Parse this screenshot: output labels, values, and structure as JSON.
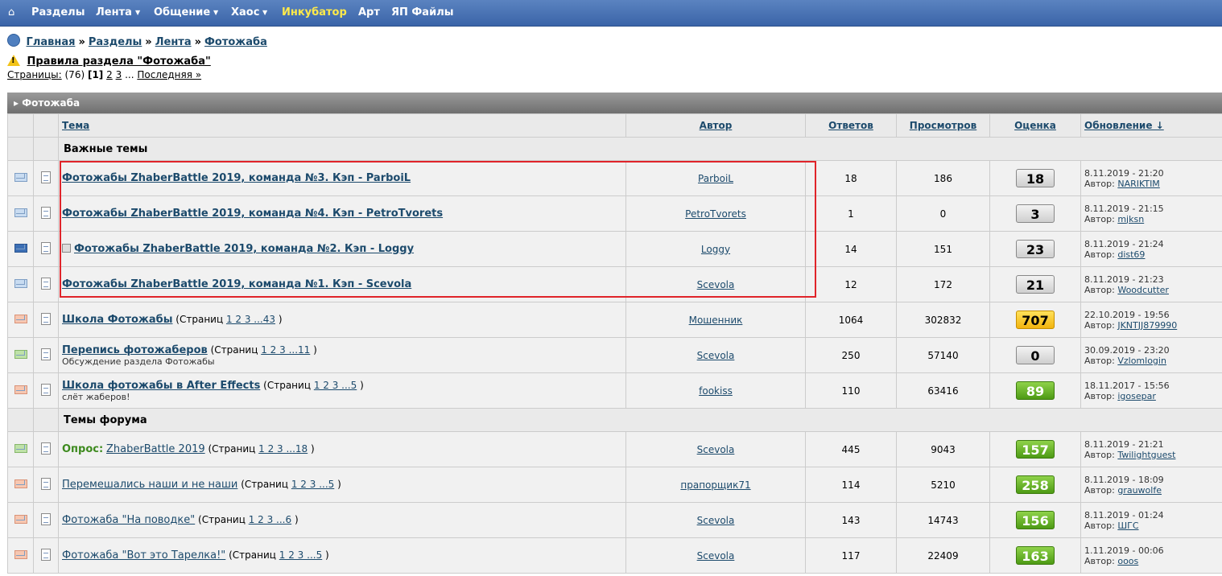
{
  "nav": {
    "home_icon": "home-icon",
    "items": [
      {
        "label": "Разделы",
        "caret": false
      },
      {
        "label": "Лента",
        "caret": true
      },
      {
        "label": "Общение",
        "caret": true
      },
      {
        "label": "Хаос",
        "caret": true
      },
      {
        "label": "Инкубатор",
        "caret": false,
        "highlight": true
      },
      {
        "label": "Арт",
        "caret": false
      },
      {
        "label": "ЯП Файлы",
        "caret": false
      }
    ]
  },
  "breadcrumb": [
    "Главная",
    "Разделы",
    "Лента",
    "Фотожаба"
  ],
  "breadcrumb_sep": "»",
  "rules_link": "Правила раздела \"Фотожаба\"",
  "pagination": {
    "label": "Страницы:",
    "count": "(76)",
    "current": "[1]",
    "pages": [
      "2",
      "3"
    ],
    "ellipsis": "...",
    "last": "Последняя »"
  },
  "forum": {
    "title": "Фотожаба",
    "columns": {
      "topic": "Тема",
      "author": "Автор",
      "replies": "Ответов",
      "views": "Просмотров",
      "rating": "Оценка",
      "updated": "Обновление ↓"
    },
    "sections": [
      {
        "title": "Важные темы",
        "rows": [
          {
            "env": "light",
            "title": "Фотожабы ZhaberBattle 2019, команда №3. Кэп - ParboiL",
            "bold": true,
            "author": "ParboiL",
            "replies": "18",
            "views": "186",
            "rating": "18",
            "rcolor": "gray",
            "date": "8.11.2019 - 21:20",
            "by_label": "Автор:",
            "by": "NARIKTIM"
          },
          {
            "env": "light",
            "title": "Фотожабы ZhaberBattle 2019, команда №4. Кэп - PetroTvorets",
            "bold": true,
            "author": "PetroTvorets",
            "replies": "1",
            "views": "0",
            "rating": "3",
            "rcolor": "gray",
            "date": "8.11.2019 - 21:15",
            "by_label": "Автор:",
            "by": "mjksn"
          },
          {
            "env": "dark",
            "title": "Фотожабы ZhaberBattle 2019, команда №2. Кэп - Loggy",
            "bold": true,
            "mini": true,
            "author": "Loggy",
            "replies": "14",
            "views": "151",
            "rating": "23",
            "rcolor": "gray",
            "date": "8.11.2019 - 21:24",
            "by_label": "Автор:",
            "by": "dist69"
          },
          {
            "env": "light",
            "title": "Фотожабы ZhaberBattle 2019, команда №1. Кэп - Scevola",
            "bold": true,
            "author": "Scevola",
            "replies": "12",
            "views": "172",
            "rating": "21",
            "rcolor": "gray",
            "date": "8.11.2019 - 21:23",
            "by_label": "Автор:",
            "by": "Woodcutter"
          },
          {
            "env": "orange",
            "title": "Школа Фотожабы",
            "bold": true,
            "pages_pre": "(Страниц ",
            "pages": "1 2 3 ...43",
            "pages_post": ")",
            "author": "Мошенник",
            "replies": "1064",
            "views": "302832",
            "rating": "707",
            "rcolor": "yellow",
            "date": "22.10.2019 - 19:56",
            "by_label": "Автор:",
            "by": "JKNTJJ879990"
          },
          {
            "env": "green",
            "title": "Перепись фотожаберов",
            "bold": true,
            "pages_pre": "(Страниц ",
            "pages": "1 2 3 ...11",
            "pages_post": ")",
            "sub": "Обсуждение раздела Фотожабы",
            "author": "Scevola",
            "replies": "250",
            "views": "57140",
            "rating": "0",
            "rcolor": "gray",
            "date": "30.09.2019 - 23:20",
            "by_label": "Автор:",
            "by": "Vzlomlogin"
          },
          {
            "env": "orange",
            "title": "Школа фотожабы в After Effects",
            "bold": true,
            "pages_pre": "(Страниц ",
            "pages": "1 2 3 ...5",
            "pages_post": ")",
            "sub": "слёт жаберов!",
            "author": "fookiss",
            "replies": "110",
            "views": "63416",
            "rating": "89",
            "rcolor": "green",
            "date": "18.11.2017 - 15:56",
            "by_label": "Автор:",
            "by": "igosepar"
          }
        ]
      },
      {
        "title": "Темы форума",
        "rows": [
          {
            "env": "green",
            "poll": "Опрос:",
            "title": "ZhaberBattle 2019",
            "bold": false,
            "pages_pre": "(Страниц ",
            "pages": "1 2 3 ...18",
            "pages_post": ")",
            "author": "Scevola",
            "replies": "445",
            "views": "9043",
            "rating": "157",
            "rcolor": "green",
            "date": "8.11.2019 - 21:21",
            "by_label": "Автор:",
            "by": "Twilightguest"
          },
          {
            "env": "orange",
            "title": "Перемешались наши и не наши",
            "bold": false,
            "pages_pre": "(Страниц ",
            "pages": "1 2 3 ...5",
            "pages_post": ")",
            "author": "прапорщик71",
            "replies": "114",
            "views": "5210",
            "rating": "258",
            "rcolor": "green",
            "date": "8.11.2019 - 18:09",
            "by_label": "Автор:",
            "by": "grauwolfe"
          },
          {
            "env": "orange",
            "title": "Фотожаба \"На поводке\"",
            "bold": false,
            "pages_pre": "(Страниц ",
            "pages": "1 2 3 ...6",
            "pages_post": ")",
            "author": "Scevola",
            "replies": "143",
            "views": "14743",
            "rating": "156",
            "rcolor": "green",
            "date": "8.11.2019 - 01:24",
            "by_label": "Автор:",
            "by": "ШГС"
          },
          {
            "env": "orange",
            "title": "Фотожаба \"Вот это Тарелка!\"",
            "bold": false,
            "pages_pre": "(Страниц ",
            "pages": "1 2 3 ...5",
            "pages_post": ")",
            "author": "Scevola",
            "replies": "117",
            "views": "22409",
            "rating": "163",
            "rcolor": "green",
            "date": "1.11.2019 - 00:06",
            "by_label": "Автор:",
            "by": "ooos"
          }
        ]
      }
    ]
  },
  "colors": {
    "nav_bg": "#3a64a8",
    "nav_highlight": "#ffea4a",
    "link": "#1c4a6c",
    "highlight_box": "#e0242a",
    "rating_green": "#4d9a14",
    "rating_yellow": "#f2b40f"
  }
}
